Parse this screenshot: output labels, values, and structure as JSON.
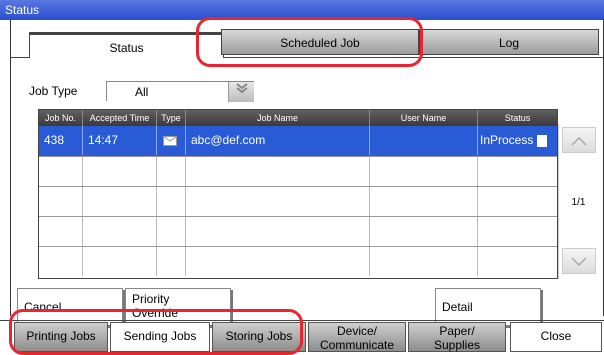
{
  "window": {
    "title": "Status"
  },
  "tabs": [
    {
      "label": "Status",
      "active": true
    },
    {
      "label": "Scheduled Job",
      "active": false
    },
    {
      "label": "Log",
      "active": false
    }
  ],
  "filter": {
    "label": "Job Type",
    "value": "All"
  },
  "table": {
    "headers": [
      "Job No.",
      "Accepted Time",
      "Type",
      "Job Name",
      "User Name",
      "Status"
    ],
    "rows": [
      {
        "job_no": "438",
        "time": "14:47",
        "type_icon": "envelope-icon",
        "job_name": "abc@def.com",
        "user_name": "",
        "status": "InProcess",
        "selected": true
      }
    ],
    "page_indicator": "1/1"
  },
  "actions": {
    "cancel": "Cancel",
    "priority_line1": "Priority",
    "priority_line2": "Override",
    "detail": "Detail"
  },
  "bottom_tabs": {
    "printing": "Printing Jobs",
    "sending": "Sending Jobs",
    "storing": "Storing Jobs",
    "device_line1": "Device/",
    "device_line2": "Communicate",
    "paper_line1": "Paper/",
    "paper_line2": "Supplies",
    "close": "Close"
  },
  "colors": {
    "titlebar": "#2a4ed0",
    "selection": "#2a5bd7",
    "highlight": "#e8262e"
  }
}
